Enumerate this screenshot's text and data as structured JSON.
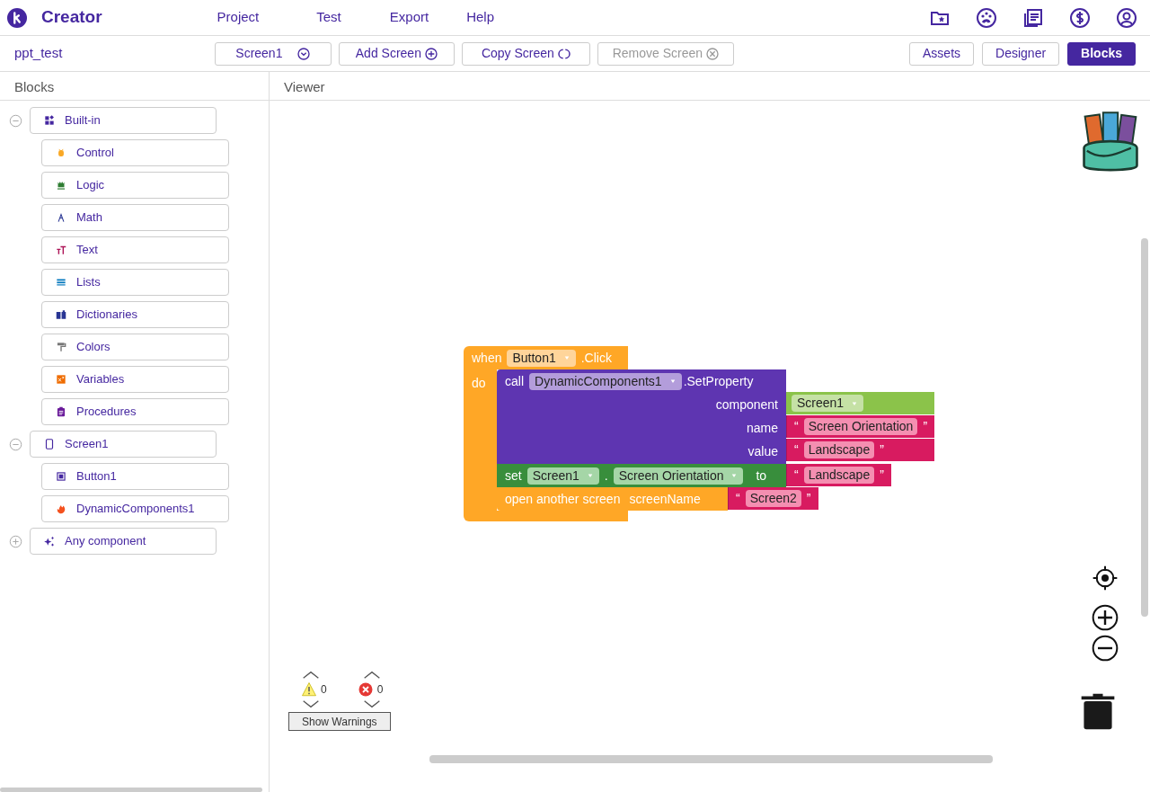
{
  "app": {
    "name": "Creator"
  },
  "menu": [
    "Project",
    "Test",
    "Export",
    "Help"
  ],
  "project": {
    "name": "ppt_test"
  },
  "screen_select": {
    "value": "Screen1"
  },
  "screen_buttons": [
    {
      "label": "Add Screen",
      "disabled": false
    },
    {
      "label": "Copy Screen",
      "disabled": false
    },
    {
      "label": "Remove Screen",
      "disabled": true
    }
  ],
  "view_tabs": [
    {
      "label": "Assets",
      "selected": false
    },
    {
      "label": "Designer",
      "selected": false
    },
    {
      "label": "Blocks",
      "selected": true
    }
  ],
  "blocks_panel": {
    "title": "Blocks",
    "tree": [
      {
        "label": "Built-in",
        "expanded": true,
        "children": [
          {
            "label": "Control"
          },
          {
            "label": "Logic"
          },
          {
            "label": "Math"
          },
          {
            "label": "Text"
          },
          {
            "label": "Lists"
          },
          {
            "label": "Dictionaries"
          },
          {
            "label": "Colors"
          },
          {
            "label": "Variables"
          },
          {
            "label": "Procedures"
          }
        ]
      },
      {
        "label": "Screen1",
        "expanded": true,
        "children": [
          {
            "label": "Button1"
          },
          {
            "label": "DynamicComponents1"
          }
        ]
      },
      {
        "label": "Any component",
        "expanded": false
      }
    ]
  },
  "viewer": {
    "title": "Viewer",
    "event_block": {
      "keyword": "when",
      "component": "Button1",
      "event": ".Click",
      "do_label": "do",
      "body": [
        {
          "kind": "call",
          "keyword": "call",
          "component": "DynamicComponents1",
          "method": ".SetProperty",
          "args": [
            {
              "label": "component",
              "value": {
                "kind": "component",
                "text": "Screen1"
              }
            },
            {
              "label": "name",
              "value": {
                "kind": "text",
                "open": "“",
                "text": "Screen Orientation",
                "close": "”"
              }
            },
            {
              "label": "value",
              "value": {
                "kind": "text",
                "open": "“",
                "text": "Landscape",
                "close": "”"
              }
            }
          ]
        },
        {
          "kind": "set",
          "keyword": "set",
          "component": "Screen1",
          "separator": ".",
          "property": "Screen Orientation",
          "to": "to",
          "value": {
            "kind": "text",
            "open": "“",
            "text": "Landscape",
            "close": "”"
          }
        },
        {
          "kind": "open",
          "keyword": "open another screen",
          "param": "screenName",
          "value": {
            "kind": "text",
            "open": "“",
            "text": "Screen2",
            "close": "”"
          }
        }
      ]
    },
    "warnings": {
      "warning_count": "0",
      "error_count": "0",
      "button": "Show Warnings"
    }
  }
}
